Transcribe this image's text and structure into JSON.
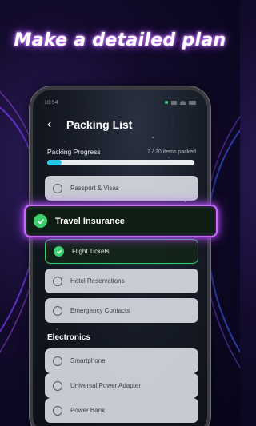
{
  "headline": "Make a detailed plan",
  "status_bar": {
    "time": "10:54"
  },
  "header": {
    "title": "Packing List"
  },
  "progress": {
    "label": "Packing Progress",
    "count_text": "2 / 20 items packed",
    "fraction": 0.1
  },
  "items": [
    {
      "label": "Passport & Visas",
      "checked": false
    },
    {
      "label": "Flight Tickets",
      "checked": true
    },
    {
      "label": "Hotel Reservations",
      "checked": false
    },
    {
      "label": "Emergency Contacts",
      "checked": false
    }
  ],
  "highlighted_item": {
    "label": "Travel Insurance",
    "checked": true
  },
  "electronics": {
    "title": "Electronics",
    "items": [
      {
        "label": "Smartphone",
        "checked": false
      },
      {
        "label": "Universal Power Adapter",
        "checked": false
      },
      {
        "label": "Power Bank",
        "checked": false
      }
    ]
  },
  "colors": {
    "accent_green": "#3bd16f",
    "progress_cyan": "#22c7e8",
    "neon_purple": "#cc66ff"
  }
}
